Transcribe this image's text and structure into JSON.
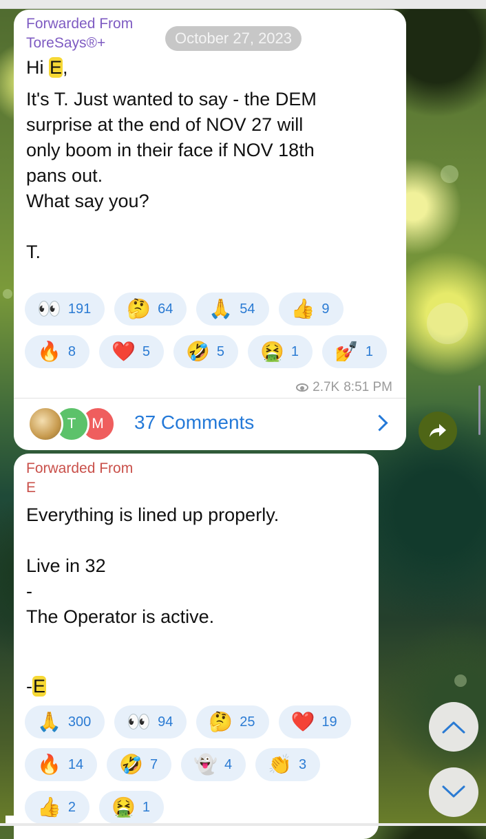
{
  "messages": [
    {
      "forwarded_label": "Forwarded From",
      "forwarded_from": "ToreSays®+",
      "date_pill": "October 27, 2023",
      "greeting_prefix": "Hi ",
      "greeting_highlight": "E",
      "greeting_suffix": ",",
      "body": "It's T. Just wanted to say - the DEM\nsurprise at the end of NOV 27 will\nonly boom in their face if NOV 18th\npans out.\nWhat say you?\n\nT.",
      "reactions": [
        [
          {
            "icon": "eyes-emoji",
            "emoji": "👀",
            "count": "191"
          },
          {
            "icon": "thinking-face-emoji",
            "emoji": "🤔",
            "count": "64"
          },
          {
            "icon": "folded-hands-emoji",
            "emoji": "🙏",
            "count": "54"
          },
          {
            "icon": "thumbs-up-emoji",
            "emoji": "👍",
            "count": "9"
          }
        ],
        [
          {
            "icon": "fire-emoji",
            "emoji": "🔥",
            "count": "8"
          },
          {
            "icon": "red-heart-emoji",
            "emoji": "❤️",
            "count": "5"
          },
          {
            "icon": "rolling-laughing-emoji",
            "emoji": "🤣",
            "count": "5"
          },
          {
            "icon": "vomiting-face-emoji",
            "emoji": "🤮",
            "count": "1"
          },
          {
            "icon": "nail-polish-emoji",
            "emoji": "💅",
            "count": "1"
          }
        ]
      ],
      "views": "2.7K",
      "time": "8:51 PM",
      "comments": {
        "avatars": [
          {
            "label": "",
            "color": "#c79a4e"
          },
          {
            "label": "T",
            "color": "#5cc26a"
          },
          {
            "label": "M",
            "color": "#ef5e5e"
          }
        ],
        "label": "37 Comments"
      }
    },
    {
      "forwarded_label": "Forwarded From",
      "forwarded_from": "E",
      "body": "Everything is lined up properly.\n\nLive in 32\n-\nThe Operator is active.\n",
      "signature_prefix": "-",
      "signature_highlight": "E",
      "reactions": [
        [
          {
            "icon": "folded-hands-emoji",
            "emoji": "🙏",
            "count": "300"
          },
          {
            "icon": "eyes-emoji",
            "emoji": "👀",
            "count": "94"
          },
          {
            "icon": "thinking-face-emoji",
            "emoji": "🤔",
            "count": "25"
          },
          {
            "icon": "red-heart-emoji",
            "emoji": "❤️",
            "count": "19"
          }
        ],
        [
          {
            "icon": "fire-emoji",
            "emoji": "🔥",
            "count": "14"
          },
          {
            "icon": "rolling-laughing-emoji",
            "emoji": "🤣",
            "count": "7"
          },
          {
            "icon": "ghost-emoji",
            "emoji": "👻",
            "count": "4"
          },
          {
            "icon": "clapping-hands-emoji",
            "emoji": "👏",
            "count": "3"
          }
        ],
        [
          {
            "icon": "thumbs-up-emoji",
            "emoji": "👍",
            "count": "2"
          },
          {
            "icon": "vomiting-face-emoji",
            "emoji": "🤮",
            "count": "1"
          }
        ]
      ]
    }
  ],
  "controls": {
    "share_icon": "share-arrow-icon",
    "scroll_up_icon": "chevron-up-icon",
    "scroll_down_icon": "chevron-down-icon"
  },
  "colors": {
    "accent_blue": "#2479d8",
    "forward_purple": "#7e5bc2",
    "forward_red": "#c9504a",
    "highlight_yellow": "#f6d835",
    "reaction_chip_bg": "#e7f0fa",
    "share_button_bg": "#4e6516"
  }
}
